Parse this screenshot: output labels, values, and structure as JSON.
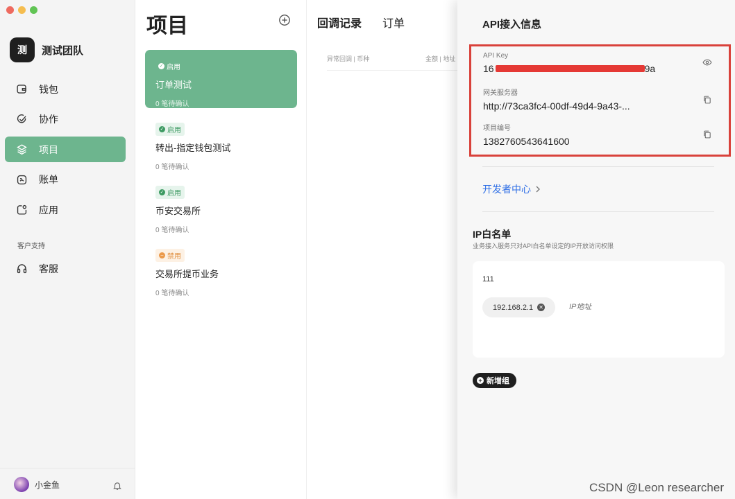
{
  "window": {
    "traffic_colors": [
      "#ee6a5f",
      "#f5bd4f",
      "#61c454"
    ]
  },
  "sidebar": {
    "team_avatar": "测",
    "team_name": "测试团队",
    "items": [
      {
        "label": "钱包",
        "icon": "wallet-icon"
      },
      {
        "label": "协作",
        "icon": "check-circle-icon"
      },
      {
        "label": "项目",
        "icon": "layers-icon",
        "active": true
      },
      {
        "label": "账单",
        "icon": "bill-icon"
      },
      {
        "label": "应用",
        "icon": "app-icon"
      }
    ],
    "support_section": "客户支持",
    "support_item": {
      "label": "客服",
      "icon": "headset-icon"
    },
    "user_name": "小金鱼"
  },
  "projects": {
    "title": "项目",
    "list": [
      {
        "status": "启用",
        "name": "订单测试",
        "pending": "0 笔待确认",
        "active": true
      },
      {
        "status": "启用",
        "name": "转出-指定钱包测试",
        "pending": "0 笔待确认"
      },
      {
        "status": "启用",
        "name": "币安交易所",
        "pending": "0 笔待确认"
      },
      {
        "status": "禁用",
        "name": "交易所提币业务",
        "pending": "0 笔待确认"
      }
    ]
  },
  "middle": {
    "tabs": [
      "回调记录",
      "订单"
    ],
    "col_left": "异常回调 | 币种",
    "col_right": "金额 | 地址"
  },
  "drawer": {
    "title": "API接入信息",
    "api_key_label": "API Key",
    "api_key_prefix": "16",
    "api_key_suffix": "9a",
    "gateway_label": "网关服务器",
    "gateway_value": "http://73ca3fc4-00df-49d4-9a43-...",
    "project_no_label": "项目编号",
    "project_no_value": "1382760543641600",
    "dev_center": "开发者中心",
    "ip_title": "IP白名单",
    "ip_desc": "业务接入服务只对API白名单设定的IP开放访问权限",
    "ip_group": "111",
    "ip_chip": "192.168.2.1",
    "ip_placeholder": "IP地址",
    "add_group": "新增组",
    "highlight_color": "#d9423b"
  },
  "watermark": "CSDN @Leon researcher"
}
